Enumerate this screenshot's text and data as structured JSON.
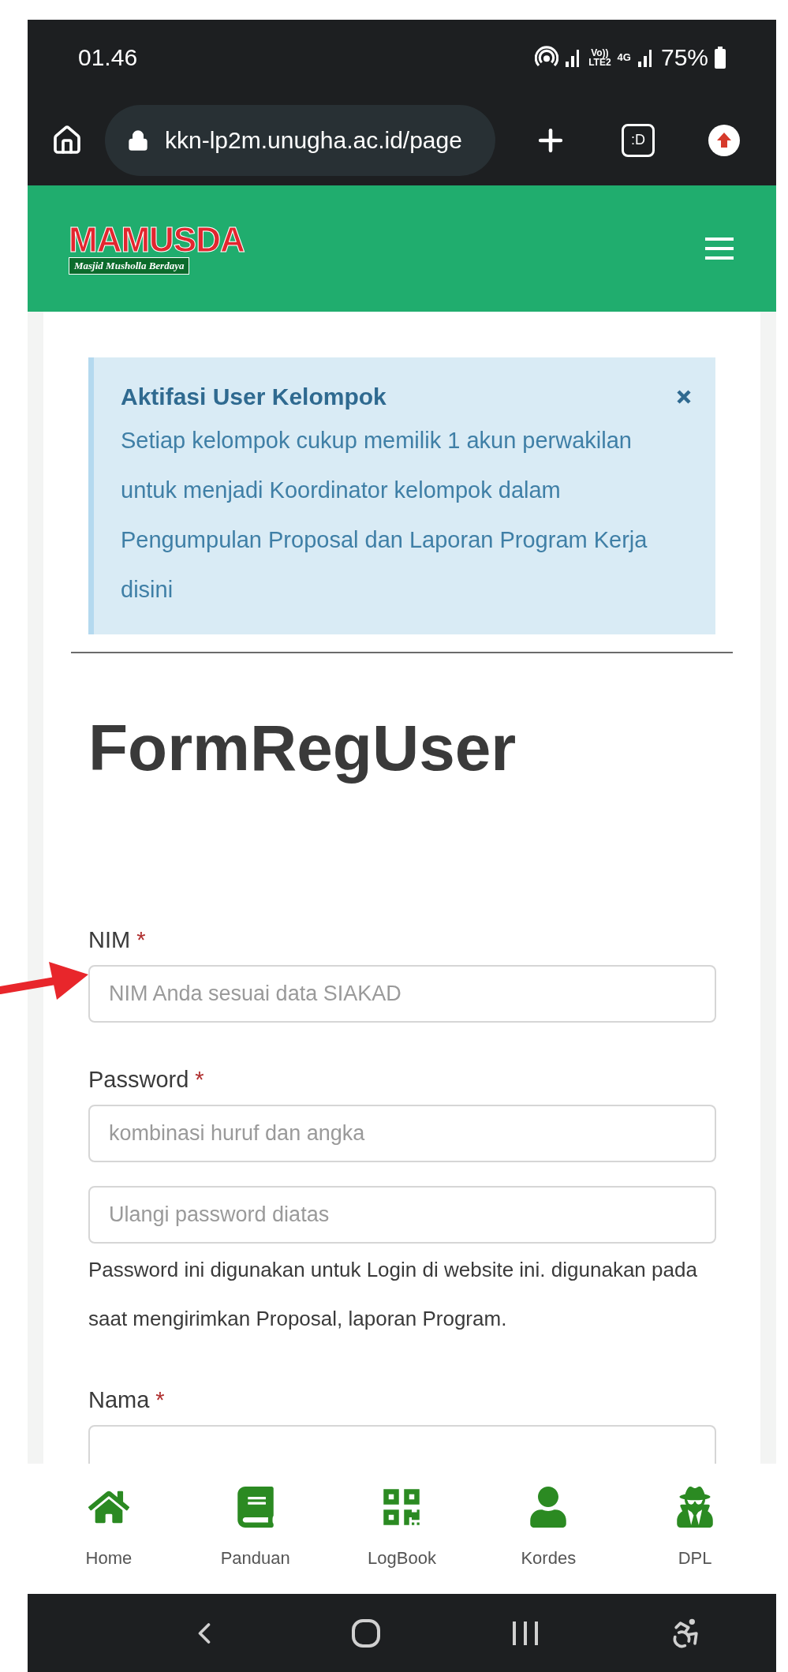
{
  "status_bar": {
    "time": "01.46",
    "volte": "Vo))",
    "lte": "LTE2",
    "data": "4G",
    "battery": "75%"
  },
  "browser": {
    "url": "kkn-lp2m.unugha.ac.id/page",
    "tab_button": ":D"
  },
  "header": {
    "logo_title": "MAMUSDA",
    "logo_subtitle": "Masjid Musholla Berdaya"
  },
  "alert": {
    "title": "Aktifasi User Kelompok",
    "text": "Setiap kelompok cukup memilik 1 akun perwakilan untuk menjadi Koordinator kelompok dalam Pengumpulan Proposal dan Laporan Program Kerja disini"
  },
  "form": {
    "title": "FormRegUser",
    "fields": [
      {
        "label": "NIM",
        "required_mark": "*",
        "inputs": [
          {
            "kind": "text",
            "placeholder": "NIM Anda sesuai data SIAKAD"
          }
        ]
      },
      {
        "label": "Password",
        "required_mark": "*",
        "inputs": [
          {
            "kind": "text",
            "placeholder": "kombinasi huruf dan angka"
          },
          {
            "kind": "text",
            "placeholder": "Ulangi password diatas"
          }
        ],
        "help": "Password ini digunakan untuk Login di website ini. digunakan pada saat mengirimkan Proposal, laporan Program."
      },
      {
        "label": "Nama",
        "required_mark": "*",
        "inputs": [
          {
            "kind": "text"
          }
        ]
      }
    ]
  },
  "bottom_nav": [
    {
      "label": "Home"
    },
    {
      "label": "Panduan"
    },
    {
      "label": "LogBook"
    },
    {
      "label": "Kordes"
    },
    {
      "label": "DPL"
    }
  ]
}
